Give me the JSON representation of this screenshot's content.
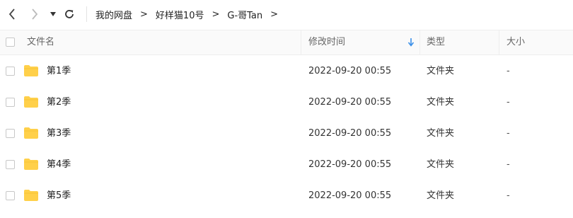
{
  "toolbar": {
    "back_icon": "chevron-left-icon",
    "forward_icon": "chevron-right-icon",
    "history_icon": "triangle-down-icon",
    "refresh_icon": "refresh-icon"
  },
  "breadcrumb": {
    "items": [
      "我的网盘",
      "好样猫10号",
      "G-哥Tan"
    ],
    "separator": ">"
  },
  "table": {
    "headers": {
      "name": "文件名",
      "modified": "修改时间",
      "type": "类型",
      "size": "大小"
    },
    "sort_icon": "arrow-down-icon",
    "sort_color": "#3a8fe8",
    "folder_color": "#ffd04a",
    "rows": [
      {
        "name": "第1季",
        "modified": "2022-09-20 00:55",
        "type": "文件夹",
        "size": "-"
      },
      {
        "name": "第2季",
        "modified": "2022-09-20 00:55",
        "type": "文件夹",
        "size": "-"
      },
      {
        "name": "第3季",
        "modified": "2022-09-20 00:55",
        "type": "文件夹",
        "size": "-"
      },
      {
        "name": "第4季",
        "modified": "2022-09-20 00:55",
        "type": "文件夹",
        "size": "-"
      },
      {
        "name": "第5季",
        "modified": "2022-09-20 00:55",
        "type": "文件夹",
        "size": "-"
      }
    ]
  }
}
